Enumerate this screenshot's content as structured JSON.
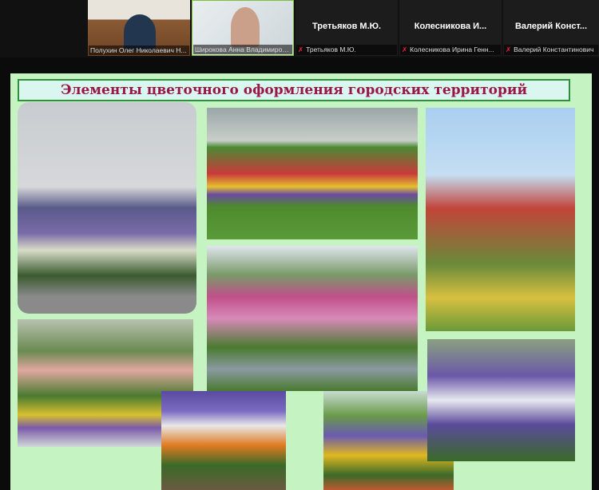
{
  "participants": [
    {
      "name": "Полухин Олег Николаевич Н...",
      "video": true
    },
    {
      "name": "Широкова Анна Владимиров...",
      "video": true
    },
    {
      "display": "Третьяков М.Ю.",
      "name": "Третьяков М.Ю.",
      "muted": true
    },
    {
      "display": "Колесникова  И...",
      "name": "Колесникова Ирина Генн...",
      "muted": true
    },
    {
      "display": "Валерий  Конст...",
      "name": "Валерий Константинович",
      "muted": true
    }
  ],
  "slide": {
    "title": "Элементы цветочного оформления городских территорий"
  },
  "colors": {
    "slide_bg": "#c6f3c2",
    "title_text": "#9a1648",
    "title_border": "#2f8f3c",
    "muted_mic": "#e22233"
  }
}
